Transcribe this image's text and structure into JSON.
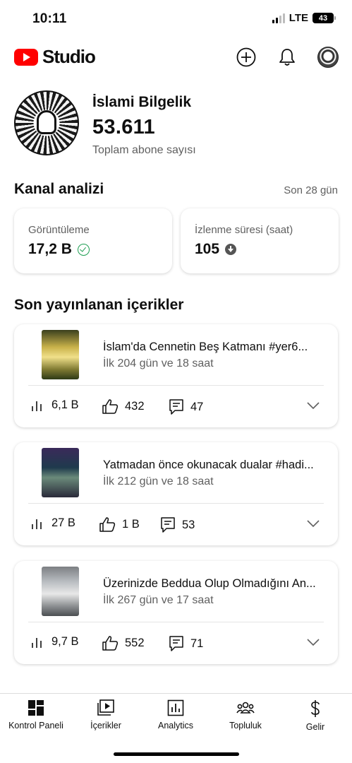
{
  "status_bar": {
    "time": "10:11",
    "network": "LTE",
    "battery": "43"
  },
  "header": {
    "logo_text": "Studio",
    "icons": [
      "create-icon",
      "notifications-bell-icon",
      "account-avatar"
    ]
  },
  "channel": {
    "name": "İslami Bilgelik",
    "subscribers": "53.611",
    "subscribers_label": "Toplam abone sayısı"
  },
  "analytics": {
    "title": "Kanal analizi",
    "period": "Son 28 gün",
    "cards": [
      {
        "label": "Görüntüleme",
        "value": "17,2 B",
        "status_icon": "check-circle-icon",
        "status_color": "#1e9e52"
      },
      {
        "label": "İzlenme süresi (saat)",
        "value": "105",
        "status_icon": "arrow-down-circle-icon",
        "status_color": "#555555"
      }
    ]
  },
  "recent": {
    "title": "Son yayınlanan içerikler",
    "videos": [
      {
        "title": "İslam'da Cennetin Beş Katmanı #yer6...",
        "meta": "İlk 204 gün ve 18 saat",
        "views": "6,1 B",
        "likes": "432",
        "comments": "47"
      },
      {
        "title": "Yatmadan önce okunacak dualar #hadi...",
        "meta": "İlk 212 gün ve 18 saat",
        "views": "27 B",
        "likes": "1 B",
        "comments": "53"
      },
      {
        "title": "Üzerinizde Beddua Olup Olmadığını An...",
        "meta": "İlk 267 gün ve 17 saat",
        "views": "9,7 B",
        "likes": "552",
        "comments": "71"
      }
    ]
  },
  "bottom_nav": {
    "items": [
      {
        "label": "Kontrol Paneli",
        "icon": "dashboard-icon"
      },
      {
        "label": "İçerikler",
        "icon": "content-icon"
      },
      {
        "label": "Analytics",
        "icon": "analytics-icon"
      },
      {
        "label": "Topluluk",
        "icon": "community-icon"
      },
      {
        "label": "Gelir",
        "icon": "earn-icon"
      }
    ]
  },
  "colors": {
    "brand_red": "#ff0000",
    "text_primary": "#0f0f0f",
    "text_secondary": "#606060"
  }
}
